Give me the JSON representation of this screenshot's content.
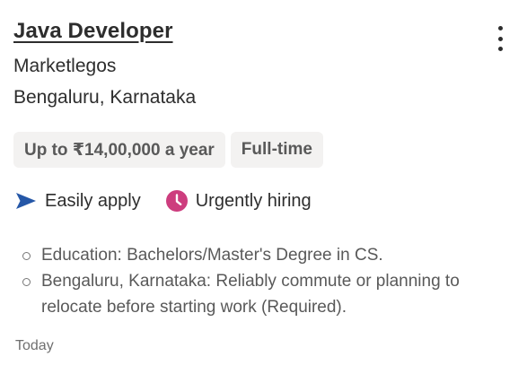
{
  "job": {
    "title": "Java Developer",
    "company": "Marketlegos",
    "location": "Bengaluru, Karnataka"
  },
  "tags": [
    "Up to ₹14,00,000 a year",
    "Full-time"
  ],
  "attributes": [
    {
      "label": "Easily apply",
      "icon": "send-arrow-icon",
      "color": "#2557a7"
    },
    {
      "label": "Urgently hiring",
      "icon": "clock-icon",
      "color": "#cd3d7e"
    }
  ],
  "snippets": [
    "Education: Bachelors/Master's Degree in CS.",
    "Bengaluru, Karnataka: Reliably commute or planning to relocate before starting work (Required)."
  ],
  "posted": "Today",
  "menu": {
    "icon": "more-vertical-icon"
  }
}
